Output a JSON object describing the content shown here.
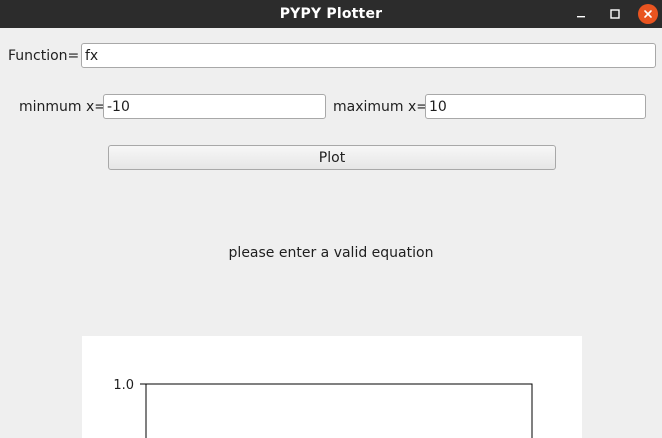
{
  "window": {
    "title": "PYPY Plotter",
    "controls": {
      "minimize_icon": "minimize-icon",
      "maximize_icon": "maximize-icon",
      "close_icon": "close-icon",
      "close_color": "#e95420"
    }
  },
  "form": {
    "function_label": "Function=",
    "function_value": "fx",
    "min_label": "minmum x=",
    "min_value": "-10",
    "max_label": "maximum x=",
    "max_value": "10",
    "plot_button_label": "Plot"
  },
  "status": {
    "message": "please enter a valid equation"
  },
  "chart_data": {
    "type": "line",
    "series": [],
    "yticks": [
      "1.0"
    ],
    "grid": false
  }
}
